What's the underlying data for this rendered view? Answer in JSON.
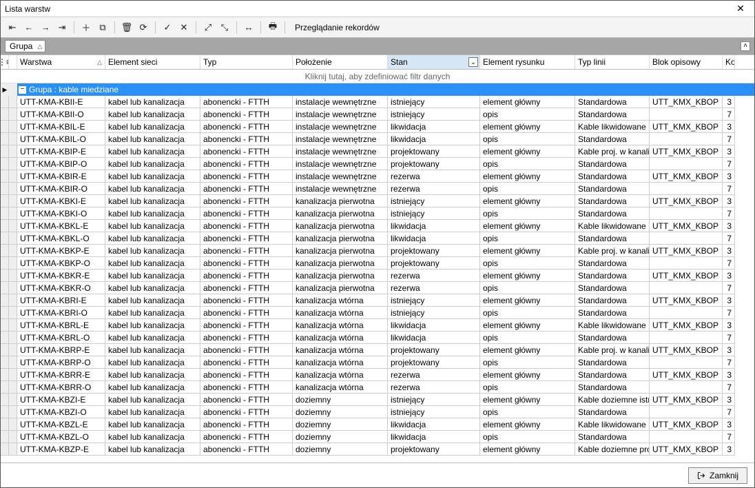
{
  "window": {
    "title": "Lista warstw"
  },
  "toolbar": {
    "label": "Przeglądanie rekordów"
  },
  "grouping": {
    "field": "Grupa"
  },
  "columns": {
    "c0": "Warstwa",
    "c1": "Element sieci",
    "c2": "Typ",
    "c3": "Położenie",
    "c4": "Stan",
    "c5": "Element rysunku",
    "c6": "Typ linii",
    "c7": "Blok opisowy",
    "c8": "Kolo"
  },
  "filter_hint": "Kliknij tutaj, aby zdefiniować filtr danych",
  "group_header": "Grupa : kable miedziane",
  "footer": {
    "close": "Zamknij"
  },
  "rows": [
    {
      "w": "UTT-KMA-KBII-E",
      "es": "kabel lub kanalizacja",
      "typ": "abonencki - FTTH",
      "pol": "instalacje wewnętrzne",
      "stan": "istniejący",
      "er": "element główny",
      "tl": "Standardowa",
      "bo": "UTT_KMX_KBOP",
      "k": "3"
    },
    {
      "w": "UTT-KMA-KBII-O",
      "es": "kabel lub kanalizacja",
      "typ": "abonencki - FTTH",
      "pol": "instalacje wewnętrzne",
      "stan": "istniejący",
      "er": "opis",
      "tl": "Standardowa",
      "bo": "",
      "k": "7"
    },
    {
      "w": "UTT-KMA-KBIL-E",
      "es": "kabel lub kanalizacja",
      "typ": "abonencki - FTTH",
      "pol": "instalacje wewnętrzne",
      "stan": "likwidacja",
      "er": "element główny",
      "tl": "Kable likwidowane",
      "bo": "UTT_KMX_KBOP",
      "k": "3"
    },
    {
      "w": "UTT-KMA-KBIL-O",
      "es": "kabel lub kanalizacja",
      "typ": "abonencki - FTTH",
      "pol": "instalacje wewnętrzne",
      "stan": "likwidacja",
      "er": "opis",
      "tl": "Standardowa",
      "bo": "",
      "k": "7"
    },
    {
      "w": "UTT-KMA-KBIP-E",
      "es": "kabel lub kanalizacja",
      "typ": "abonencki - FTTH",
      "pol": "instalacje wewnętrzne",
      "stan": "projektowany",
      "er": "element główny",
      "tl": "Kable proj. w kanalizacji",
      "bo": "UTT_KMX_KBOP",
      "k": "3"
    },
    {
      "w": "UTT-KMA-KBIP-O",
      "es": "kabel lub kanalizacja",
      "typ": "abonencki - FTTH",
      "pol": "instalacje wewnętrzne",
      "stan": "projektowany",
      "er": "opis",
      "tl": "Standardowa",
      "bo": "",
      "k": "7"
    },
    {
      "w": "UTT-KMA-KBIR-E",
      "es": "kabel lub kanalizacja",
      "typ": "abonencki - FTTH",
      "pol": "instalacje wewnętrzne",
      "stan": "rezerwa",
      "er": "element główny",
      "tl": "Standardowa",
      "bo": "UTT_KMX_KBOP",
      "k": "3"
    },
    {
      "w": "UTT-KMA-KBIR-O",
      "es": "kabel lub kanalizacja",
      "typ": "abonencki - FTTH",
      "pol": "instalacje wewnętrzne",
      "stan": "rezerwa",
      "er": "opis",
      "tl": "Standardowa",
      "bo": "",
      "k": "7"
    },
    {
      "w": "UTT-KMA-KBKI-E",
      "es": "kabel lub kanalizacja",
      "typ": "abonencki - FTTH",
      "pol": "kanalizacja pierwotna",
      "stan": "istniejący",
      "er": "element główny",
      "tl": "Standardowa",
      "bo": "UTT_KMX_KBOP",
      "k": "3"
    },
    {
      "w": "UTT-KMA-KBKI-O",
      "es": "kabel lub kanalizacja",
      "typ": "abonencki - FTTH",
      "pol": "kanalizacja pierwotna",
      "stan": "istniejący",
      "er": "opis",
      "tl": "Standardowa",
      "bo": "",
      "k": "7"
    },
    {
      "w": "UTT-KMA-KBKL-E",
      "es": "kabel lub kanalizacja",
      "typ": "abonencki - FTTH",
      "pol": "kanalizacja pierwotna",
      "stan": "likwidacja",
      "er": "element główny",
      "tl": "Kable likwidowane",
      "bo": "UTT_KMX_KBOP",
      "k": "3"
    },
    {
      "w": "UTT-KMA-KBKL-O",
      "es": "kabel lub kanalizacja",
      "typ": "abonencki - FTTH",
      "pol": "kanalizacja pierwotna",
      "stan": "likwidacja",
      "er": "opis",
      "tl": "Standardowa",
      "bo": "",
      "k": "7"
    },
    {
      "w": "UTT-KMA-KBKP-E",
      "es": "kabel lub kanalizacja",
      "typ": "abonencki - FTTH",
      "pol": "kanalizacja pierwotna",
      "stan": "projektowany",
      "er": "element główny",
      "tl": "Kable proj. w kanalizacji",
      "bo": "UTT_KMX_KBOP",
      "k": "3"
    },
    {
      "w": "UTT-KMA-KBKP-O",
      "es": "kabel lub kanalizacja",
      "typ": "abonencki - FTTH",
      "pol": "kanalizacja pierwotna",
      "stan": "projektowany",
      "er": "opis",
      "tl": "Standardowa",
      "bo": "",
      "k": "7"
    },
    {
      "w": "UTT-KMA-KBKR-E",
      "es": "kabel lub kanalizacja",
      "typ": "abonencki - FTTH",
      "pol": "kanalizacja pierwotna",
      "stan": "rezerwa",
      "er": "element główny",
      "tl": "Standardowa",
      "bo": "UTT_KMX_KBOP",
      "k": "3"
    },
    {
      "w": "UTT-KMA-KBKR-O",
      "es": "kabel lub kanalizacja",
      "typ": "abonencki - FTTH",
      "pol": "kanalizacja pierwotna",
      "stan": "rezerwa",
      "er": "opis",
      "tl": "Standardowa",
      "bo": "",
      "k": "7"
    },
    {
      "w": "UTT-KMA-KBRI-E",
      "es": "kabel lub kanalizacja",
      "typ": "abonencki - FTTH",
      "pol": "kanalizacja wtórna",
      "stan": "istniejący",
      "er": "element główny",
      "tl": "Standardowa",
      "bo": "UTT_KMX_KBOP",
      "k": "3"
    },
    {
      "w": "UTT-KMA-KBRI-O",
      "es": "kabel lub kanalizacja",
      "typ": "abonencki - FTTH",
      "pol": "kanalizacja wtórna",
      "stan": "istniejący",
      "er": "opis",
      "tl": "Standardowa",
      "bo": "",
      "k": "7"
    },
    {
      "w": "UTT-KMA-KBRL-E",
      "es": "kabel lub kanalizacja",
      "typ": "abonencki - FTTH",
      "pol": "kanalizacja wtórna",
      "stan": "likwidacja",
      "er": "element główny",
      "tl": "Kable likwidowane",
      "bo": "UTT_KMX_KBOP",
      "k": "3"
    },
    {
      "w": "UTT-KMA-KBRL-O",
      "es": "kabel lub kanalizacja",
      "typ": "abonencki - FTTH",
      "pol": "kanalizacja wtórna",
      "stan": "likwidacja",
      "er": "opis",
      "tl": "Standardowa",
      "bo": "",
      "k": "7"
    },
    {
      "w": "UTT-KMA-KBRP-E",
      "es": "kabel lub kanalizacja",
      "typ": "abonencki - FTTH",
      "pol": "kanalizacja wtórna",
      "stan": "projektowany",
      "er": "element główny",
      "tl": "Kable proj. w kanalizacji",
      "bo": "UTT_KMX_KBOP",
      "k": "3"
    },
    {
      "w": "UTT-KMA-KBRP-O",
      "es": "kabel lub kanalizacja",
      "typ": "abonencki - FTTH",
      "pol": "kanalizacja wtórna",
      "stan": "projektowany",
      "er": "opis",
      "tl": "Standardowa",
      "bo": "",
      "k": "7"
    },
    {
      "w": "UTT-KMA-KBRR-E",
      "es": "kabel lub kanalizacja",
      "typ": "abonencki - FTTH",
      "pol": "kanalizacja wtórna",
      "stan": "rezerwa",
      "er": "element główny",
      "tl": "Standardowa",
      "bo": "UTT_KMX_KBOP",
      "k": "3"
    },
    {
      "w": "UTT-KMA-KBRR-O",
      "es": "kabel lub kanalizacja",
      "typ": "abonencki - FTTH",
      "pol": "kanalizacja wtórna",
      "stan": "rezerwa",
      "er": "opis",
      "tl": "Standardowa",
      "bo": "",
      "k": "7"
    },
    {
      "w": "UTT-KMA-KBZI-E",
      "es": "kabel lub kanalizacja",
      "typ": "abonencki - FTTH",
      "pol": "doziemny",
      "stan": "istniejący",
      "er": "element główny",
      "tl": "Kable doziemne istniejące",
      "bo": "UTT_KMX_KBOP",
      "k": "3"
    },
    {
      "w": "UTT-KMA-KBZI-O",
      "es": "kabel lub kanalizacja",
      "typ": "abonencki - FTTH",
      "pol": "doziemny",
      "stan": "istniejący",
      "er": "opis",
      "tl": "Standardowa",
      "bo": "",
      "k": "7"
    },
    {
      "w": "UTT-KMA-KBZL-E",
      "es": "kabel lub kanalizacja",
      "typ": "abonencki - FTTH",
      "pol": "doziemny",
      "stan": "likwidacja",
      "er": "element główny",
      "tl": "Kable likwidowane",
      "bo": "UTT_KMX_KBOP",
      "k": "3"
    },
    {
      "w": "UTT-KMA-KBZL-O",
      "es": "kabel lub kanalizacja",
      "typ": "abonencki - FTTH",
      "pol": "doziemny",
      "stan": "likwidacja",
      "er": "opis",
      "tl": "Standardowa",
      "bo": "",
      "k": "7"
    },
    {
      "w": "UTT-KMA-KBZP-E",
      "es": "kabel lub kanalizacja",
      "typ": "abonencki - FTTH",
      "pol": "doziemny",
      "stan": "projektowany",
      "er": "element główny",
      "tl": "Kable doziemne proj.",
      "bo": "UTT_KMX_KBOP",
      "k": "3"
    }
  ]
}
